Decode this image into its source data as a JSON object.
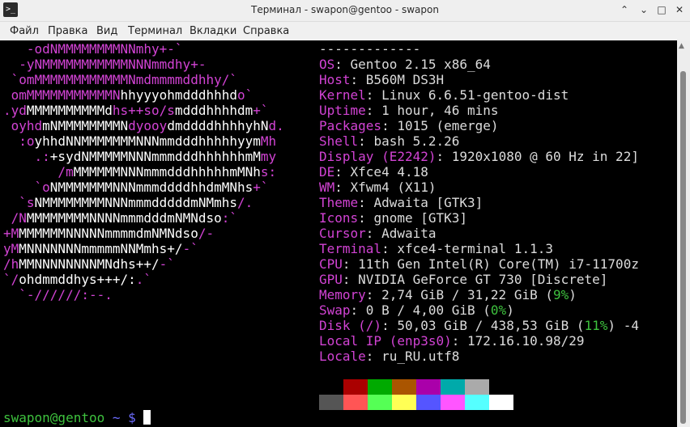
{
  "window": {
    "title": "Терминал - swapon@gentoo - swapon",
    "icon": "terminal-icon",
    "controls": {
      "collapse": "⌃",
      "minimize": "⌄",
      "maximize": "□",
      "close": "✕"
    }
  },
  "menu": [
    "Файл",
    "Правка",
    "Вид",
    "Терминал",
    "Вкладки",
    "Справка"
  ],
  "logo": [
    [
      [
        "tm",
        "   -odNMMMMMMMMNNmhy+-`"
      ]
    ],
    [
      [
        "tm",
        "  -yNMMMMMMMMMMMNNNmmdhy+-"
      ]
    ],
    [
      [
        "tm",
        " `omMMMMMMMMMMMMNmdmmmmddhhy/`"
      ]
    ],
    [
      [
        "tm",
        " omMMMMMMMMMMMN"
      ],
      [
        "tw",
        "hhyyyohmdddhhhd"
      ],
      [
        "tm",
        "o`"
      ]
    ],
    [
      [
        "tm",
        ".yd"
      ],
      [
        "tw",
        "MMMMMMMMMMd"
      ],
      [
        "tm",
        "hs++so/s"
      ],
      [
        "tw",
        "mdddhhhhdm"
      ],
      [
        "tm",
        "+`"
      ]
    ],
    [
      [
        "tm",
        " oyhd"
      ],
      [
        "tw",
        "mNMMMMMMMMN"
      ],
      [
        "tm",
        "dyooy"
      ],
      [
        "tw",
        "dmddddhhhhyhN"
      ],
      [
        "tm",
        "d."
      ]
    ],
    [
      [
        "tm",
        "  :o"
      ],
      [
        "tw",
        "yhhdNNMMMMMMMNNNmmdddhhhhhyym"
      ],
      [
        "tm",
        "Mh"
      ]
    ],
    [
      [
        "tm",
        "    .:"
      ],
      [
        "tw",
        "+sydNMMMMMNNNmmmdddhhhhhhmM"
      ],
      [
        "tm",
        "my"
      ]
    ],
    [
      [
        "tm",
        "       /m"
      ],
      [
        "tw",
        "MMMMMMNNNmmmdddhhhhhmMNh"
      ],
      [
        "tm",
        "s:"
      ]
    ],
    [
      [
        "tm",
        "    `o"
      ],
      [
        "tw",
        "NMMMMMMMNNNmmmddddhhdmMNhs"
      ],
      [
        "tm",
        "+`"
      ]
    ],
    [
      [
        "tm",
        "  `s"
      ],
      [
        "tw",
        "NMMMMMMMMNNNmmmdddddmNMmhs"
      ],
      [
        "tm",
        "/."
      ]
    ],
    [
      [
        "tm",
        " /N"
      ],
      [
        "tw",
        "MMMMMMMMNNNNmmmdddmNMNdso"
      ],
      [
        "tm",
        ":`"
      ]
    ],
    [
      [
        "tm",
        "+M"
      ],
      [
        "tw",
        "MMMMMMNNNNNmmmmdmNMNdso"
      ],
      [
        "tm",
        "/-"
      ]
    ],
    [
      [
        "tm",
        "yM"
      ],
      [
        "tw",
        "MNNNNNNNmmmmmNNMmhs+/"
      ],
      [
        "tm",
        "-`"
      ]
    ],
    [
      [
        "tm",
        "/h"
      ],
      [
        "tw",
        "MMNNNNNNNNMNdhs++/"
      ],
      [
        "tm",
        "-`"
      ]
    ],
    [
      [
        "tm",
        "`/"
      ],
      [
        "tw",
        "ohdmmddhys+++/:"
      ],
      [
        "tm",
        ".`"
      ]
    ],
    [
      [
        "tm",
        "  `-//////:--."
      ]
    ]
  ],
  "info": [
    {
      "key": "",
      "text": "-------------"
    },
    {
      "key": "OS",
      "text": "Gentoo 2.15 x86_64"
    },
    {
      "key": "Host",
      "text": "B560M DS3H"
    },
    {
      "key": "Kernel",
      "text": "Linux 6.6.51-gentoo-dist"
    },
    {
      "key": "Uptime",
      "text": "1 hour, 46 mins"
    },
    {
      "key": "Packages",
      "text": "1015 (emerge)"
    },
    {
      "key": "Shell",
      "text": "bash 5.2.26"
    },
    {
      "key": "Display (E2242)",
      "text": "1920x1080 @ 60 Hz in 22]"
    },
    {
      "key": "DE",
      "text": "Xfce4 4.18"
    },
    {
      "key": "WM",
      "text": "Xfwm4 (X11)"
    },
    {
      "key": "Theme",
      "text": "Adwaita [GTK3]"
    },
    {
      "key": "Icons",
      "text": "gnome [GTK3]"
    },
    {
      "key": "Cursor",
      "text": "Adwaita"
    },
    {
      "key": "Terminal",
      "text": "xfce4-terminal 1.1.3"
    },
    {
      "key": "CPU",
      "text": "11th Gen Intel(R) Core(TM) i7-11700z"
    },
    {
      "key": "GPU",
      "text": "NVIDIA GeForce GT 730 [Discrete]"
    },
    {
      "key": "Memory",
      "text": "2,74 GiB / 31,22 GiB (",
      "pct": "9%",
      "after": ")"
    },
    {
      "key": "Swap",
      "text": "0 B / 4,00 GiB (",
      "pct": "0%",
      "after": ")"
    },
    {
      "key": "Disk (/)",
      "text": "50,03 GiB / 438,53 GiB (",
      "pct": "11%",
      "after": ") -4"
    },
    {
      "key": "Local IP (enp3s0)",
      "text": "172.16.10.98/29"
    },
    {
      "key": "Locale",
      "text": "ru_RU.utf8"
    }
  ],
  "palette": {
    "normal": [
      "#000000",
      "#aa0000",
      "#00aa00",
      "#aa5500",
      "#aa00aa",
      "#00aaaa",
      "#aaaaaa"
    ],
    "bright": [
      "#555555",
      "#ff5555",
      "#55ff55",
      "#ffff55",
      "#5555ff",
      "#ff55ff",
      "#55ffff",
      "#ffffff"
    ]
  },
  "prompt": {
    "user": "swapon@gentoo",
    "path": "~",
    "symbol": "$"
  }
}
